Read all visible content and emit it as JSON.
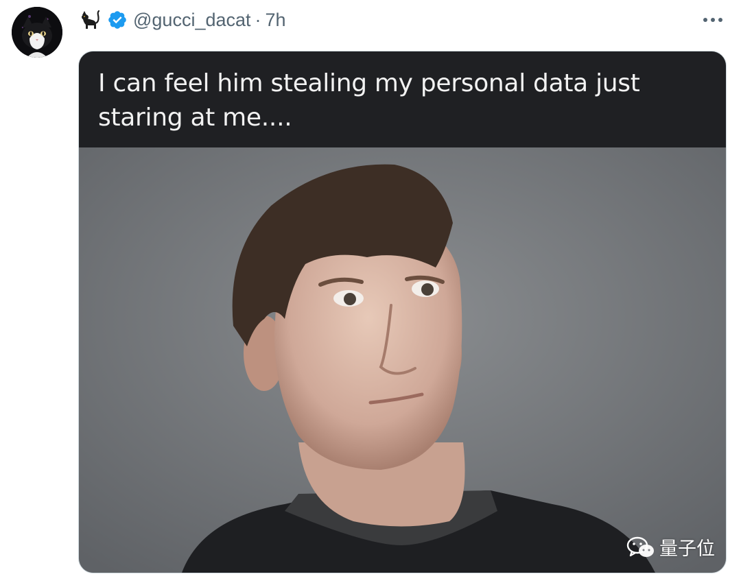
{
  "tweet": {
    "handle": "@gucci_dacat",
    "separator": "·",
    "time": "7h",
    "author_emoji": "black-cat-icon",
    "verified_color": "#1d9bf0"
  },
  "media": {
    "caption": "I can feel him stealing my personal data just staring at me....",
    "watermark_text": "量子位",
    "watermark_icon": "wechat-icon"
  }
}
